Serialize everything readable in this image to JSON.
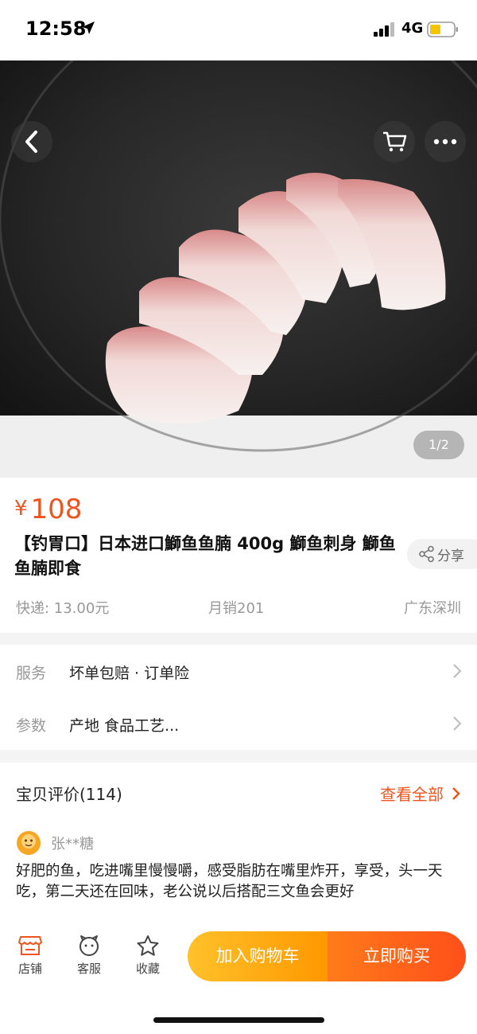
{
  "status_bar": {
    "time": "12:58",
    "network": "4G"
  },
  "gallery": {
    "pager": "1/2"
  },
  "product": {
    "currency": "¥",
    "price": "108",
    "title": "【钓胃口】日本进口鰤鱼鱼腩 400g 鰤鱼刺身  鰤鱼鱼腩即食",
    "share_label": "分享",
    "shipping": "快递: 13.00元",
    "monthly_sales": "月销201",
    "location": "广东深圳"
  },
  "service": {
    "rows": [
      {
        "key": "服务",
        "value": "坏单包赔 · 订单险"
      },
      {
        "key": "参数",
        "value": "产地 食品工艺..."
      }
    ]
  },
  "reviews": {
    "header": "宝贝评价(114)",
    "view_all": "查看全部",
    "user": "张**糖",
    "text": "好肥的鱼，吃进嘴里慢慢嚼，感受脂肪在嘴里炸开，享受，头一天吃，第二天还在回味，老公说以后搭配三文鱼会更好"
  },
  "bottom_bar": {
    "shop_label": "店铺",
    "service_label": "客服",
    "favorite_label": "收藏",
    "add_to_cart": "加入购物车",
    "buy_now": "立即购买"
  },
  "colors": {
    "accent": "#f0541e",
    "cart_button": "#ffa51e",
    "buy_button": "#ff5a1a"
  }
}
